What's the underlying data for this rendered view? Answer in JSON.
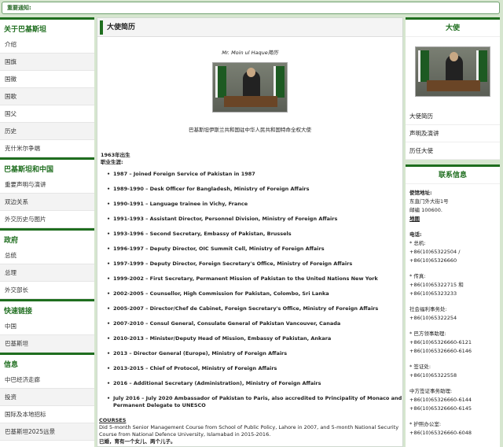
{
  "notice": "重要通知:",
  "left": {
    "sections": [
      {
        "title": "关于巴基斯坦",
        "items": [
          "介绍",
          "国旗",
          "国徽",
          "国歌",
          "国父",
          "历史",
          "克什米尔争端"
        ]
      },
      {
        "title": "巴基斯坦和中国",
        "items": [
          "重要声明与演讲",
          "双边关系",
          "外交历史与图片"
        ]
      },
      {
        "title": "政府",
        "items": [
          "总统",
          "总理",
          "外交部长"
        ]
      },
      {
        "title": "快速链接",
        "items": [
          "中国",
          "巴基斯坦"
        ]
      },
      {
        "title": "信息",
        "items": [
          "中巴经济走廊",
          "投资",
          "国际及本地招标",
          "巴基斯坦2025远景"
        ]
      }
    ]
  },
  "main": {
    "title": "大使简历",
    "caption": "Mr. Moin ul Haque简历",
    "subline": "巴基斯坦伊斯兰共和国驻中华人民共和国特命全权大使",
    "born": "1963年出生",
    "career_label": "职业生涯:",
    "career": [
      "1987 – Joined Foreign Service of Pakistan in 1987",
      "1989-1990 – Desk Officer for Bangladesh, Ministry of Foreign Affairs",
      "1990-1991 – Language trainee in Vichy, France",
      "1991-1993 – Assistant Director, Personnel Division, Ministry of Foreign Affairs",
      "1993-1996 – Second Secretary, Embassy of Pakistan, Brussels",
      "1996-1997 – Deputy Director, OIC Summit Cell, Ministry of Foreign Affairs",
      "1997-1999 – Deputy Director, Foreign Secretary's Office, Ministry of Foreign Affairs",
      "1999-2002 – First Secretary, Permanent Mission of Pakistan to the United Nations New York",
      "2002-2005 – Counsellor, High Commission for Pakistan, Colombo, Sri Lanka",
      "2005-2007 – Director/Chef de Cabinet, Foreign Secretary's Office, Ministry of Foreign Affairs",
      "2007-2010 – Consul General, Consulate General of Pakistan Vancouver, Canada",
      "2010-2013 – Minister/Deputy Head of Mission, Embassy of Pakistan, Ankara",
      "2013 – Director General (Europe), Ministry of Foreign Affairs",
      "2013-2015 – Chief of Protocol, Ministry of Foreign Affairs",
      "2016 – Additional Secretary (Administration), Ministry of Foreign Affairs",
      "July 2016 – July 2020 Ambassador of Pakistan to Paris, also accredited to Principality of Monaco and Permanent Delegate to UNESCO"
    ],
    "courses_heading": "COURSES",
    "courses_text": "Did 5-month Senior Management Course from School of Public Policy, Lahore in 2007, and 5-month National Security Course from National Defence University, Islamabad in 2015-2016.",
    "family": "已婚，育有一个女儿、两个儿子。"
  },
  "right": {
    "ambassador_title": "大使",
    "links": [
      "大使简历",
      "声明及演讲",
      "历任大使"
    ],
    "contact_title": "联系信息",
    "contact": {
      "address_label": "使馆地址:",
      "address_1": "东直门外大街1号",
      "postcode": "邮编 100600.",
      "map": "地图",
      "phone_label": "电话:",
      "main_label": "* 总机:",
      "main": "+86(10)65322504 / +86(10)65326660",
      "fax_label": "* 传真:",
      "fax_1": "+86(10)65322715 和",
      "fax_2": "+86(10)65323233",
      "welfare_label": "社会福利事务处:",
      "welfare": "+86(10)65322254",
      "consular_label": "* 巴方领事助理:",
      "consular_1": "+86(10)65326660-6121",
      "consular_2": "+86(10)65326660-6146",
      "visa_label": "* 签证处:",
      "visa": "+86(10)65322558",
      "cn_visa_label": "中方签证事务助理:",
      "cn_visa_1": "+86(10)65326660-6144",
      "cn_visa_2": "+86(10)65326660-6145",
      "passport_label": "* 护照办公室:",
      "passport": "+86(10)65326660-6048"
    }
  }
}
